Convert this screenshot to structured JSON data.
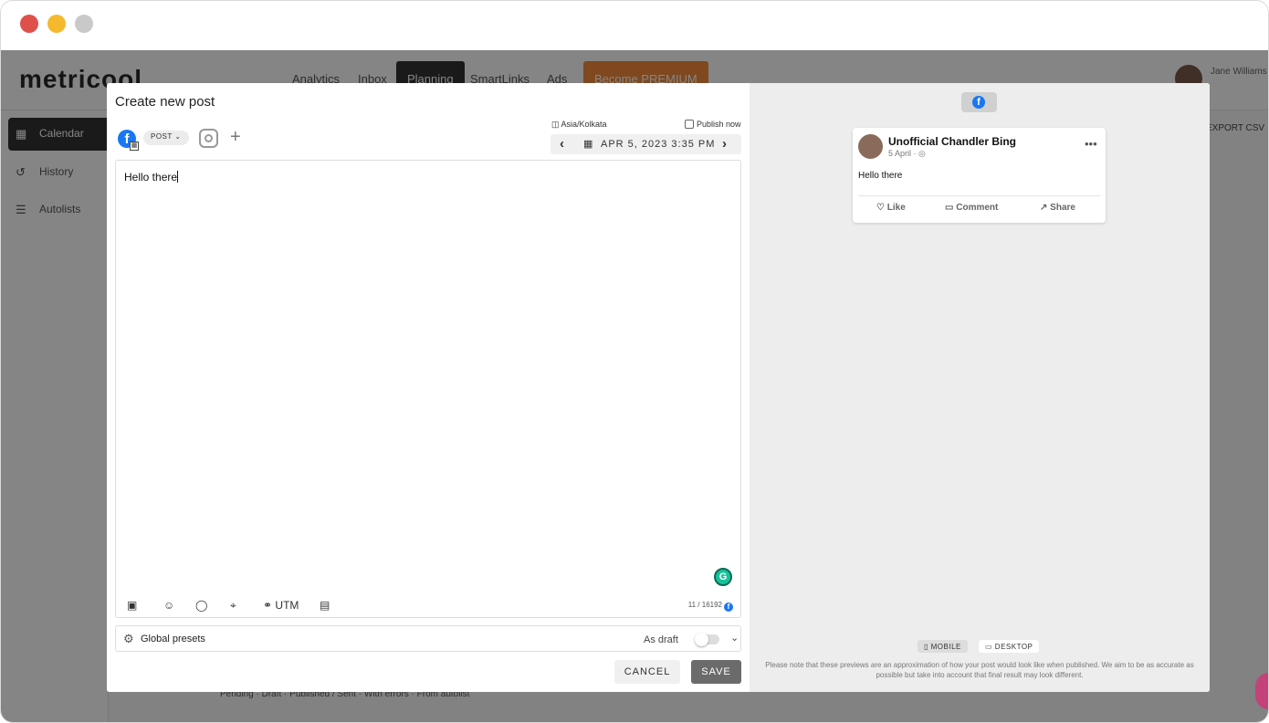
{
  "app": {
    "logo": "metricool",
    "nav": [
      "Analytics",
      "Inbox",
      "Planning",
      "SmartLinks",
      "Ads"
    ],
    "premium_label": "Become PREMIUM",
    "user_name": "Jane Williams",
    "sidebar": [
      {
        "label": "Calendar",
        "icon": "calendar-icon"
      },
      {
        "label": "History",
        "icon": "history-icon"
      },
      {
        "label": "Autolists",
        "icon": "list-icon"
      }
    ],
    "export_label": "EXPORT CSV",
    "legend": [
      "Pending",
      "Draft",
      "Published / Sent",
      "With errors",
      "From autolist"
    ]
  },
  "modal": {
    "title": "Create new post",
    "post_type": "POST",
    "timezone": "Asia/Kolkata",
    "publish_now_label": "Publish now",
    "date_text": "APR 5, 2023 3:35 PM",
    "editor_text": "Hello there",
    "toolbar": {
      "utm": "UTM"
    },
    "char_counter": "11 / 16192",
    "presets_label": "Global presets",
    "draft_label": "As draft",
    "cancel_label": "CANCEL",
    "save_label": "SAVE"
  },
  "preview": {
    "page_name": "Unofficial Chandler Bing",
    "date": "5 April ·",
    "text": "Hello there",
    "actions": [
      "Like",
      "Comment",
      "Share"
    ],
    "mobile_label": "MOBILE",
    "desktop_label": "DESKTOP",
    "disclaimer": "Please note that these previews are an approximation of how your post would look like when published. We aim to be as accurate as possible but take into account that final result may look different."
  },
  "colors": {
    "facebook": "#1877f2",
    "premium": "#f38a3b",
    "grammarly": "#15c39a"
  }
}
